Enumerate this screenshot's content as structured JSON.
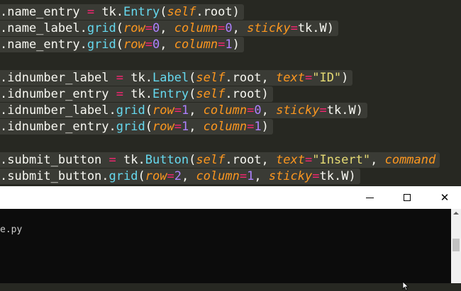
{
  "colors": {
    "editor_bg": "#272822",
    "line_highlight": "#3a3b35",
    "text": "#f8f8f2",
    "operator": "#f92672",
    "class": "#66d9ef",
    "self_param": "#fd971f",
    "number": "#ae81ff",
    "string": "#e6db74",
    "console_bg": "#0c0c0c",
    "titlebar_bg": "#ffffff"
  },
  "code": {
    "lines": [
      [
        {
          "t": ".name_entry ",
          "c": "text"
        },
        {
          "t": "=",
          "c": "operator"
        },
        {
          "t": " tk.",
          "c": "text"
        },
        {
          "t": "Entry",
          "c": "class"
        },
        {
          "t": "(",
          "c": "text"
        },
        {
          "t": "self",
          "c": "self_param"
        },
        {
          "t": ".root)",
          "c": "text"
        }
      ],
      [
        {
          "t": ".name_label.",
          "c": "text"
        },
        {
          "t": "grid",
          "c": "class"
        },
        {
          "t": "(",
          "c": "text"
        },
        {
          "t": "row",
          "c": "self_param"
        },
        {
          "t": "=",
          "c": "operator"
        },
        {
          "t": "0",
          "c": "number"
        },
        {
          "t": ", ",
          "c": "text"
        },
        {
          "t": "column",
          "c": "self_param"
        },
        {
          "t": "=",
          "c": "operator"
        },
        {
          "t": "0",
          "c": "number"
        },
        {
          "t": ", ",
          "c": "text"
        },
        {
          "t": "sticky",
          "c": "self_param"
        },
        {
          "t": "=",
          "c": "operator"
        },
        {
          "t": "tk.W)",
          "c": "text"
        }
      ],
      [
        {
          "t": ".name_entry.",
          "c": "text"
        },
        {
          "t": "grid",
          "c": "class"
        },
        {
          "t": "(",
          "c": "text"
        },
        {
          "t": "row",
          "c": "self_param"
        },
        {
          "t": "=",
          "c": "operator"
        },
        {
          "t": "0",
          "c": "number"
        },
        {
          "t": ", ",
          "c": "text"
        },
        {
          "t": "column",
          "c": "self_param"
        },
        {
          "t": "=",
          "c": "operator"
        },
        {
          "t": "1",
          "c": "number"
        },
        {
          "t": ")",
          "c": "text"
        }
      ],
      [],
      [
        {
          "t": ".idnumber_label ",
          "c": "text"
        },
        {
          "t": "=",
          "c": "operator"
        },
        {
          "t": " tk.",
          "c": "text"
        },
        {
          "t": "Label",
          "c": "class"
        },
        {
          "t": "(",
          "c": "text"
        },
        {
          "t": "self",
          "c": "self_param"
        },
        {
          "t": ".root, ",
          "c": "text"
        },
        {
          "t": "text",
          "c": "self_param"
        },
        {
          "t": "=",
          "c": "operator"
        },
        {
          "t": "\"ID\"",
          "c": "string"
        },
        {
          "t": ")",
          "c": "text"
        }
      ],
      [
        {
          "t": ".idnumber_entry ",
          "c": "text"
        },
        {
          "t": "=",
          "c": "operator"
        },
        {
          "t": " tk.",
          "c": "text"
        },
        {
          "t": "Entry",
          "c": "class"
        },
        {
          "t": "(",
          "c": "text"
        },
        {
          "t": "self",
          "c": "self_param"
        },
        {
          "t": ".root)",
          "c": "text"
        }
      ],
      [
        {
          "t": ".idnumber_label.",
          "c": "text"
        },
        {
          "t": "grid",
          "c": "class"
        },
        {
          "t": "(",
          "c": "text"
        },
        {
          "t": "row",
          "c": "self_param"
        },
        {
          "t": "=",
          "c": "operator"
        },
        {
          "t": "1",
          "c": "number"
        },
        {
          "t": ", ",
          "c": "text"
        },
        {
          "t": "column",
          "c": "self_param"
        },
        {
          "t": "=",
          "c": "operator"
        },
        {
          "t": "0",
          "c": "number"
        },
        {
          "t": ", ",
          "c": "text"
        },
        {
          "t": "sticky",
          "c": "self_param"
        },
        {
          "t": "=",
          "c": "operator"
        },
        {
          "t": "tk.W)",
          "c": "text"
        }
      ],
      [
        {
          "t": ".idnumber_entry.",
          "c": "text"
        },
        {
          "t": "grid",
          "c": "class"
        },
        {
          "t": "(",
          "c": "text"
        },
        {
          "t": "row",
          "c": "self_param"
        },
        {
          "t": "=",
          "c": "operator"
        },
        {
          "t": "1",
          "c": "number"
        },
        {
          "t": ", ",
          "c": "text"
        },
        {
          "t": "column",
          "c": "self_param"
        },
        {
          "t": "=",
          "c": "operator"
        },
        {
          "t": "1",
          "c": "number"
        },
        {
          "t": ")",
          "c": "text"
        }
      ],
      [],
      [
        {
          "t": ".submit_button ",
          "c": "text"
        },
        {
          "t": "=",
          "c": "operator"
        },
        {
          "t": " tk.",
          "c": "text"
        },
        {
          "t": "Button",
          "c": "class"
        },
        {
          "t": "(",
          "c": "text"
        },
        {
          "t": "self",
          "c": "self_param"
        },
        {
          "t": ".root, ",
          "c": "text"
        },
        {
          "t": "text",
          "c": "self_param"
        },
        {
          "t": "=",
          "c": "operator"
        },
        {
          "t": "\"Insert\"",
          "c": "string"
        },
        {
          "t": ", ",
          "c": "text"
        },
        {
          "t": "command",
          "c": "self_param"
        }
      ],
      [
        {
          "t": ".submit_button.",
          "c": "text"
        },
        {
          "t": "grid",
          "c": "class"
        },
        {
          "t": "(",
          "c": "text"
        },
        {
          "t": "row",
          "c": "self_param"
        },
        {
          "t": "=",
          "c": "operator"
        },
        {
          "t": "2",
          "c": "number"
        },
        {
          "t": ", ",
          "c": "text"
        },
        {
          "t": "column",
          "c": "self_param"
        },
        {
          "t": "=",
          "c": "operator"
        },
        {
          "t": "1",
          "c": "number"
        },
        {
          "t": ", ",
          "c": "text"
        },
        {
          "t": "sticky",
          "c": "self_param"
        },
        {
          "t": "=",
          "c": "operator"
        },
        {
          "t": "tk.W)",
          "c": "text"
        }
      ]
    ]
  },
  "console": {
    "output_text": "e.py",
    "window_buttons": {
      "minimize_icon": "minimize-icon",
      "maximize_icon": "maximize-icon",
      "close_icon": "close-icon",
      "close_glyph": "✕"
    }
  }
}
